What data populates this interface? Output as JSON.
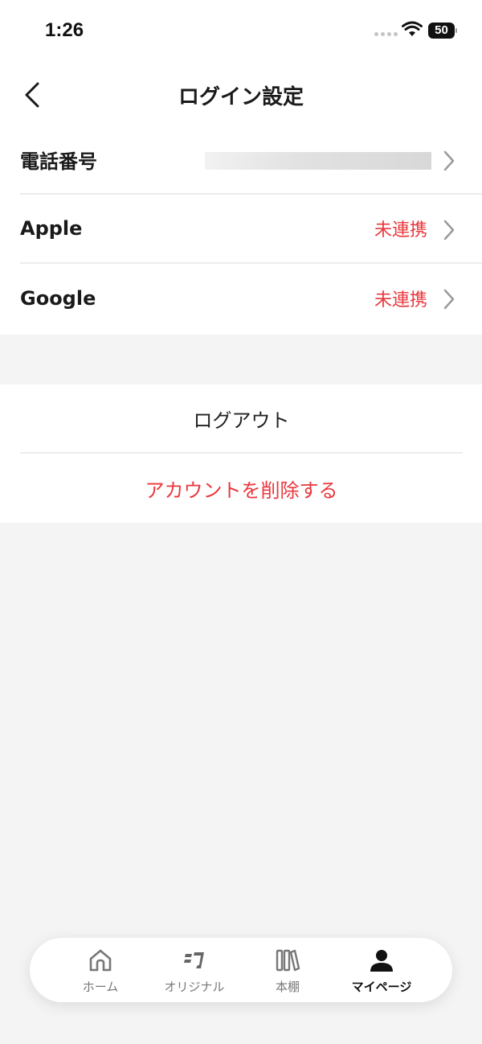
{
  "status_bar": {
    "time": "1:26",
    "battery": "50"
  },
  "header": {
    "title": "ログイン設定"
  },
  "accounts": [
    {
      "label": "電話番号",
      "status": ""
    },
    {
      "label": "Apple",
      "status": "未連携"
    },
    {
      "label": "Google",
      "status": "未連携"
    }
  ],
  "actions": {
    "logout": "ログアウト",
    "delete_account": "アカウントを削除する"
  },
  "tab_bar": {
    "items": [
      {
        "label": "ホーム",
        "icon": "home-icon"
      },
      {
        "label": "オリジナル",
        "icon": "original-icon"
      },
      {
        "label": "本棚",
        "icon": "bookshelf-icon"
      },
      {
        "label": "マイページ",
        "icon": "person-icon"
      }
    ],
    "active": "マイページ"
  },
  "colors": {
    "accent": "#e8383d",
    "background": "#f4f4f4",
    "card": "#ffffff"
  }
}
